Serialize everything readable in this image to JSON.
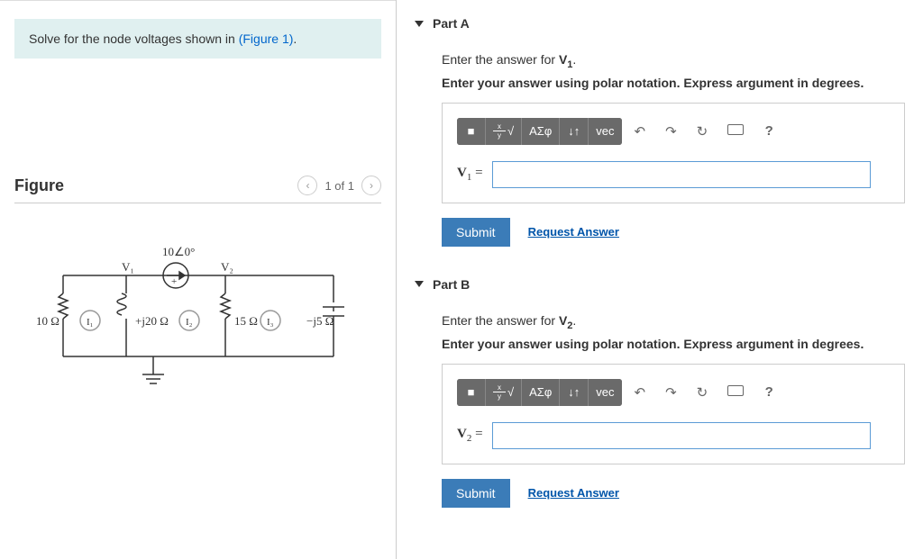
{
  "instruction": {
    "prefix": "Solve for the node voltages shown in ",
    "link_text": "(Figure 1)",
    "suffix": "."
  },
  "figure": {
    "title": "Figure",
    "nav_text": "1 of 1",
    "labels": {
      "source": "10∠0°",
      "v1": "V₁",
      "v2": "V₂",
      "r1": "10 Ω",
      "i1": "I₁",
      "xl": "+j20 Ω",
      "i2": "I₂",
      "r2": "15 Ω",
      "i3": "I₃",
      "xc": "−j5 Ω"
    }
  },
  "toolbar": {
    "templates": "■",
    "fraction": "x/y",
    "sqrt": "√",
    "greek": "ΑΣφ",
    "subscript": "↓↑",
    "vec": "vec",
    "undo": "↶",
    "redo": "↷",
    "reset": "↻",
    "keyboard": "⌨",
    "help": "?"
  },
  "parts": {
    "a": {
      "title": "Part A",
      "prompt1_prefix": "Enter the answer for ",
      "prompt1_var": "V",
      "prompt1_sub": "1",
      "prompt2": "Enter your answer using polar notation. Express argument in degrees.",
      "var_label_html": "V₁ =",
      "submit": "Submit",
      "request": "Request Answer"
    },
    "b": {
      "title": "Part B",
      "prompt1_prefix": "Enter the answer for ",
      "prompt1_var": "V",
      "prompt1_sub": "2",
      "prompt2": "Enter your answer using polar notation. Express argument in degrees.",
      "var_label_html": "V₂ =",
      "submit": "Submit",
      "request": "Request Answer"
    }
  }
}
